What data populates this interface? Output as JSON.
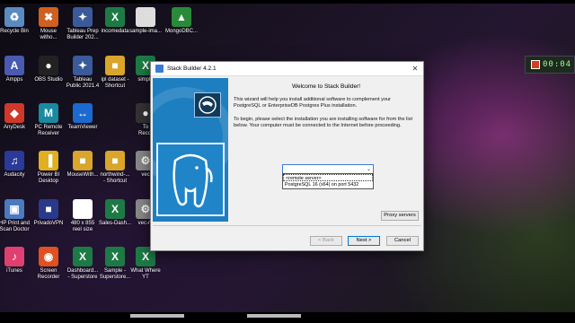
{
  "desktop": {
    "icons": [
      {
        "label": "Recycle Bin",
        "glyph": "♻",
        "color": "#5a8ac0"
      },
      {
        "label": "Mouse\nwitho...",
        "glyph": "✖",
        "color": "#d06020"
      },
      {
        "label": "Tableau Prep\nBuilder 202...",
        "glyph": "✦",
        "color": "#3a5a9a"
      },
      {
        "label": "incomedata",
        "glyph": "X",
        "color": "#1d7a45"
      },
      {
        "label": "sample-ima...",
        "glyph": "",
        "color": "#dddddd"
      },
      {
        "label": "MongoDBC...",
        "glyph": "▲",
        "color": "#2a8a3a"
      },
      {
        "label": "Ampps",
        "glyph": "A",
        "color": "#4a5ab0"
      },
      {
        "label": "OBS Studio",
        "glyph": "●",
        "color": "#222222"
      },
      {
        "label": "Tableau\nPublic 2021.4",
        "glyph": "✦",
        "color": "#3a5a9a"
      },
      {
        "label": "ipl dataset -\nShortcut",
        "glyph": "■",
        "color": "#d9a52a"
      },
      {
        "label": "simple",
        "glyph": "X",
        "color": "#1d7a45"
      },
      {
        "label": "AnyDesk",
        "glyph": "◆",
        "color": "#d0382a"
      },
      {
        "label": "PC Remote\nReceiver",
        "glyph": "M",
        "color": "#1a8aa0"
      },
      {
        "label": "TeamViewer",
        "glyph": "↔",
        "color": "#1a6ad0"
      },
      {
        "label": "To\nRecor",
        "glyph": "●",
        "color": "#333333"
      },
      {
        "label": "Audacity",
        "glyph": "♫",
        "color": "#2a3a9a"
      },
      {
        "label": "Power BI\nDesktop",
        "glyph": "▐",
        "color": "#e0b020"
      },
      {
        "label": "MouseWith...",
        "glyph": "■",
        "color": "#d9a52a"
      },
      {
        "label": "northwind-...\n- Shortcut",
        "glyph": "■",
        "color": "#d9a52a"
      },
      {
        "label": "vec",
        "glyph": "⚙",
        "color": "#888888"
      },
      {
        "label": "HP Print and\nScan Doctor",
        "glyph": "▣",
        "color": "#4a7ac0"
      },
      {
        "label": "PrivadoVPN",
        "glyph": "■",
        "color": "#2a3a8a"
      },
      {
        "label": "480 x 855\nreel size",
        "glyph": "□",
        "color": "#ffffff"
      },
      {
        "label": "Sales-Dash...",
        "glyph": "X",
        "color": "#1d7a45"
      },
      {
        "label": "vec-re",
        "glyph": "⚙",
        "color": "#888888"
      },
      {
        "label": "iTunes",
        "glyph": "♪",
        "color": "#e04070"
      },
      {
        "label": "Screen\nRecorder",
        "glyph": "◉",
        "color": "#e05020"
      },
      {
        "label": "Dashboard...\n- Superstore",
        "glyph": "X",
        "color": "#1d7a45"
      },
      {
        "label": "Sample -\nSuperstore...",
        "glyph": "X",
        "color": "#1d7a45"
      },
      {
        "label": "What Where\nYT",
        "glyph": "X",
        "color": "#1d7a45"
      }
    ],
    "clock_time": "00:04"
  },
  "window": {
    "title": "Stack Builder 4.2.1",
    "close_glyph": "✕",
    "heading": "Welcome to Stack Builder!",
    "paragraph1": "This wizard will help you install additional software to complement your PostgreSQL or EnterpriseDB Postgres Plus installation.",
    "paragraph2": "To begin, please select the installation you are installing software for from the list below. Your computer must be connected to the Internet before proceeding.",
    "combo_value": "",
    "combo_arrow": "⌄",
    "options": [
      "<remote server>",
      "PostgreSQL 16 (x64) on port 5432"
    ],
    "proxy_button": "Proxy servers",
    "back_button": "< Back",
    "next_button": "Next >",
    "cancel_button": "Cancel"
  }
}
